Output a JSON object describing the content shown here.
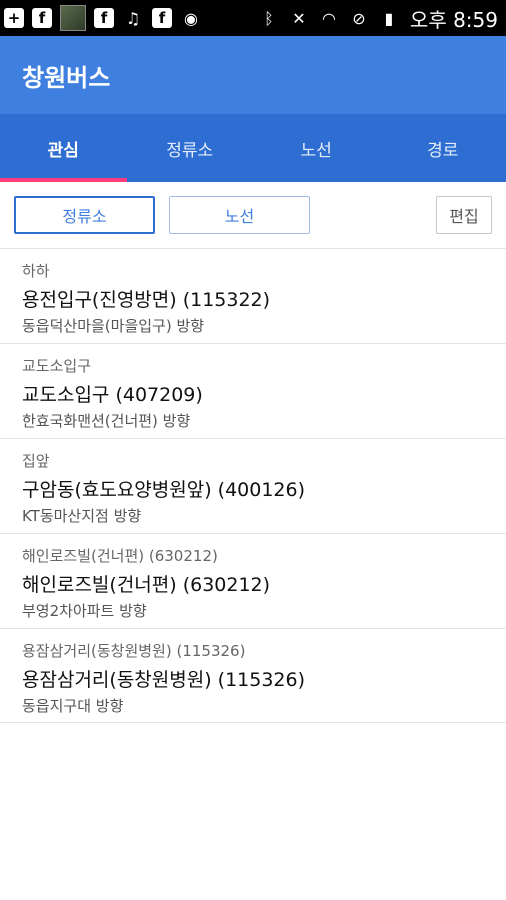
{
  "status_bar": {
    "time": "오후 8:59",
    "left_icons": [
      "plus-icon",
      "facebook-icon",
      "photo-icon",
      "facebook-icon",
      "music-icon",
      "facebook-icon",
      "eye-icon"
    ],
    "right_icons": [
      "bluetooth-icon",
      "mute-icon",
      "wifi-icon",
      "block-icon",
      "battery-icon"
    ]
  },
  "app": {
    "title": "창원버스"
  },
  "tabs": [
    {
      "label": "관심",
      "active": true
    },
    {
      "label": "정류소",
      "active": false
    },
    {
      "label": "노선",
      "active": false
    },
    {
      "label": "경로",
      "active": false
    }
  ],
  "filter": {
    "stop_label": "정류소",
    "route_label": "노선",
    "edit_label": "편집"
  },
  "favorites": [
    {
      "alias": "하하",
      "stop": "용전입구(진영방면) (115322)",
      "direction": "동읍덕산마을(마을입구) 방향"
    },
    {
      "alias": "교도소입구",
      "stop": "교도소입구 (407209)",
      "direction": "한효국화맨션(건너편) 방향"
    },
    {
      "alias": "집앞",
      "stop": "구암동(효도요양병원앞) (400126)",
      "direction": "KT동마산지점 방향"
    },
    {
      "alias": "해인로즈빌(건너편) (630212)",
      "stop": "해인로즈빌(건너편) (630212)",
      "direction": "부영2차아파트 방향"
    },
    {
      "alias": "용잠삼거리(동창원병원) (115326)",
      "stop": "용잠삼거리(동창원병원) (115326)",
      "direction": "동읍지구대 방향"
    }
  ],
  "colors": {
    "appbar": "#3f7fe0",
    "tabbar": "#2e6dd1",
    "tab_indicator": "#ff3b7f"
  }
}
